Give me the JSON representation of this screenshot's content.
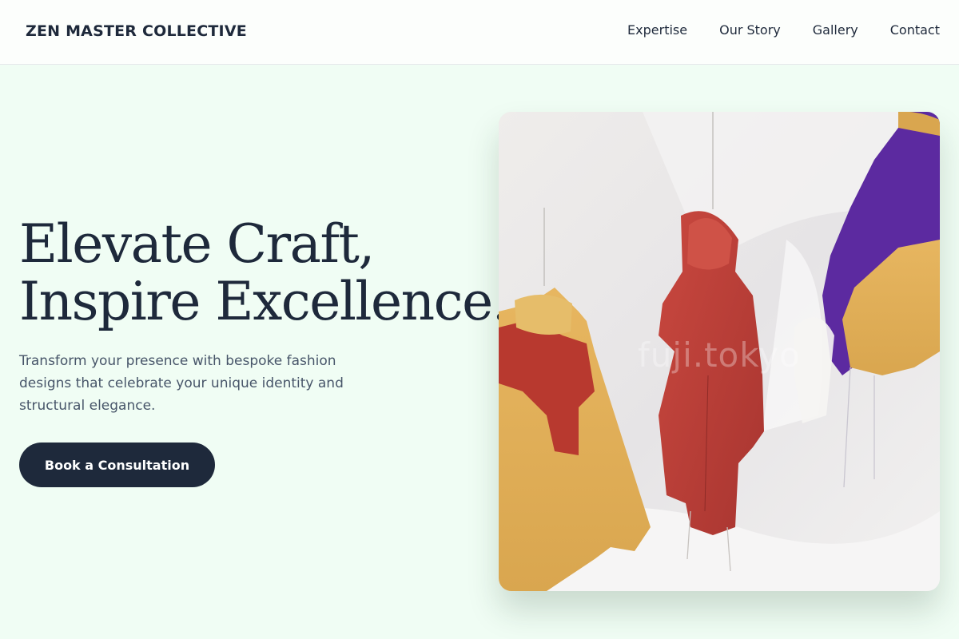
{
  "header": {
    "brand": "ZEN MASTER COLLECTIVE",
    "nav": [
      "Expertise",
      "Our Story",
      "Gallery",
      "Contact"
    ]
  },
  "hero": {
    "title_line1": "Elevate Craft,",
    "title_line2": "Inspire Excellence.",
    "subtitle": "Transform your presence with bespoke fashion designs that celebrate your unique identity and structural elegance.",
    "cta_label": "Book a Consultation"
  },
  "image": {
    "alt": "Colorful translucent jackets hanging from strings",
    "watermark": "fuji.tokyo"
  },
  "colors": {
    "page_bg": "#f0fdf4",
    "text_dark": "#1e293b",
    "text_muted": "#475569",
    "button_bg": "#1e293b"
  }
}
